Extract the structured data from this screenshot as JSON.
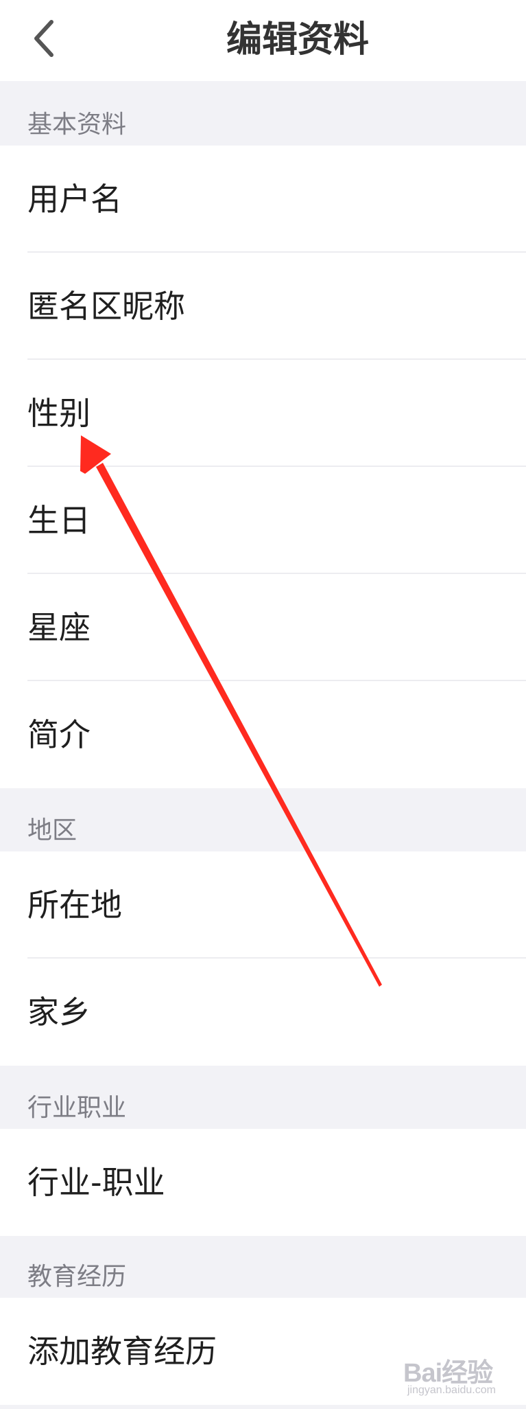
{
  "header": {
    "title": "编辑资料",
    "back_icon": "chevron-left-icon"
  },
  "sections": [
    {
      "title": "基本资料",
      "items": [
        "用户名",
        "匿名区昵称",
        "性别",
        "生日",
        "星座",
        "简介"
      ]
    },
    {
      "title": "地区",
      "items": [
        "所在地",
        "家乡"
      ]
    },
    {
      "title": "行业职业",
      "items": [
        "行业-职业"
      ]
    },
    {
      "title": "教育经历",
      "items": [
        "添加教育经历"
      ]
    }
  ],
  "annotation": {
    "type": "red-arrow",
    "points_to": "性别",
    "color": "#ff2a1f"
  },
  "watermark": {
    "main": "Bai经验",
    "sub": "jingyan.baidu.com"
  },
  "colors": {
    "background": "#f2f2f6",
    "row": "#ffffff",
    "section_text": "#7d7d85",
    "label_text": "#1f1f1f"
  }
}
